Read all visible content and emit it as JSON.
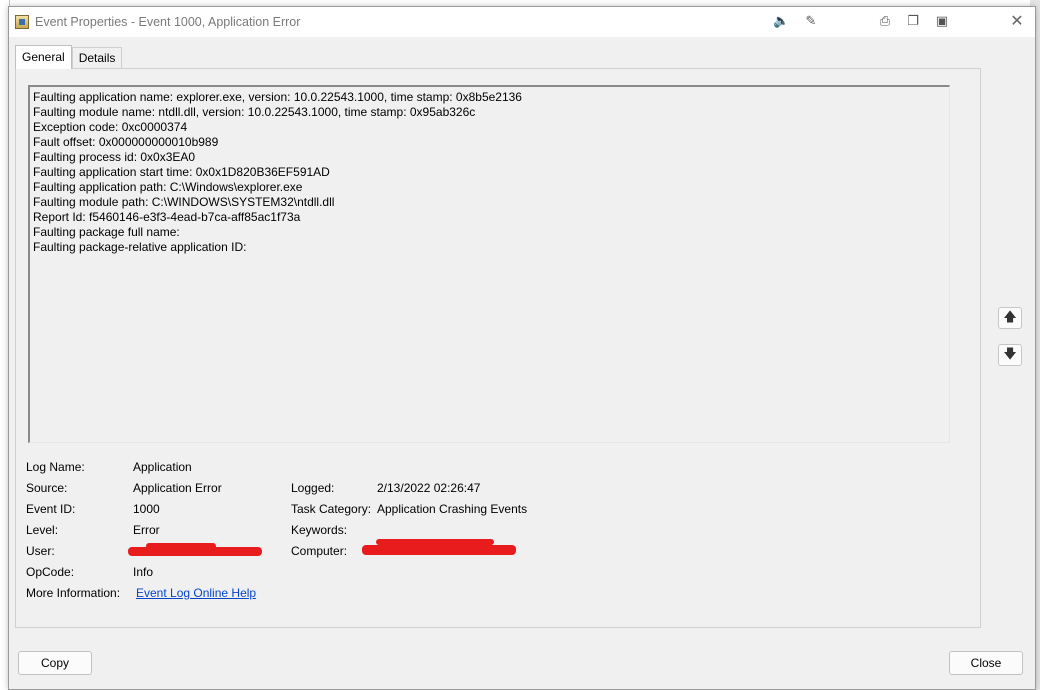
{
  "window": {
    "title": "Event Properties - Event 1000, Application Error",
    "close_glyph": "✕"
  },
  "titlebar_icons": [
    "speaker-icon",
    "pin-icon",
    "printer-icon",
    "copy-icon",
    "window-icon"
  ],
  "tabs": [
    {
      "label": "General",
      "active": true
    },
    {
      "label": "Details",
      "active": false
    }
  ],
  "description_lines": [
    "Faulting application name: explorer.exe, version: 10.0.22543.1000, time stamp: 0x8b5e2136",
    "Faulting module name: ntdll.dll, version: 10.0.22543.1000, time stamp: 0x95ab326c",
    "Exception code: 0xc0000374",
    "Fault offset: 0x000000000010b989",
    "Faulting process id: 0x0x3EA0",
    "Faulting application start time: 0x0x1D820B36EF591AD",
    "Faulting application path: C:\\Windows\\explorer.exe",
    "Faulting module path: C:\\WINDOWS\\SYSTEM32\\ntdll.dll",
    "Report Id: f5460146-e3f3-4ead-b7ca-aff85ac1f73a",
    "Faulting package full name:",
    "Faulting package-relative application ID:"
  ],
  "fields": {
    "log_name": {
      "label": "Log Name:",
      "value": "Application"
    },
    "source": {
      "label": "Source:",
      "value": "Application Error"
    },
    "event_id": {
      "label": "Event ID:",
      "value": "1000"
    },
    "level": {
      "label": "Level:",
      "value": "Error"
    },
    "user": {
      "label": "User:",
      "value": ""
    },
    "opcode": {
      "label": "OpCode:",
      "value": "Info"
    },
    "more_info": {
      "label": "More Information:",
      "value": "Event Log Online Help"
    },
    "logged": {
      "label": "Logged:",
      "value": "2/13/2022 02:26:47"
    },
    "task_category": {
      "label": "Task Category:",
      "value": "Application Crashing Events"
    },
    "keywords": {
      "label": "Keywords:",
      "value": ""
    },
    "computer": {
      "label": "Computer:",
      "value": ""
    }
  },
  "redaction_color": "#e81c1c",
  "nav": {
    "up_glyph": "🡅",
    "down_glyph": "🡇"
  },
  "buttons": {
    "copy": "Copy",
    "close": "Close"
  }
}
